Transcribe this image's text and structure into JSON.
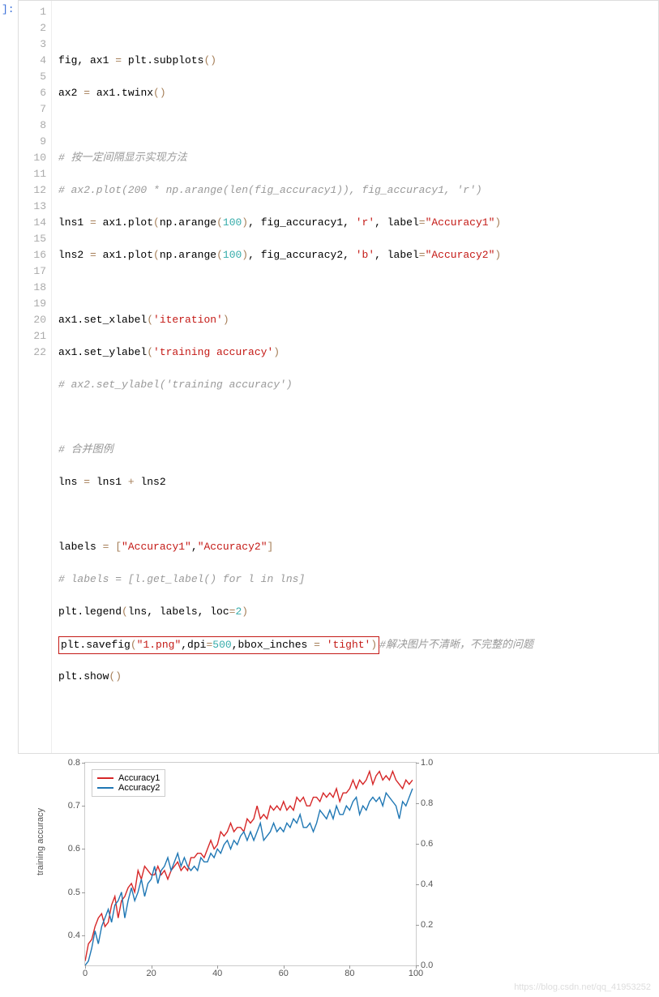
{
  "code": {
    "lines": [
      "",
      "fig, ax1 = plt.subplots()",
      "ax2 = ax1.twinx()",
      "",
      "# 按一定间隔显示实现方法",
      "# ax2.plot(200 * np.arange(len(fig_accuracy1)), fig_accuracy1, 'r')",
      "lns1 = ax1.plot(np.arange(100), fig_accuracy1, 'r', label=\"Accuracy1\")",
      "lns2 = ax1.plot(np.arange(100), fig_accuracy2, 'b', label=\"Accuracy2\")",
      "",
      "ax1.set_xlabel('iteration')",
      "ax1.set_ylabel('training accuracy')",
      "# ax2.set_ylabel('training accuracy')",
      "",
      "# 合并图例",
      "lns = lns1 + lns2",
      "",
      "labels = [\"Accuracy1\",\"Accuracy2\"]",
      "# labels = [l.get_label() for l in lns]",
      "plt.legend(lns, labels, loc=2)",
      "plt.savefig(\"1.png\",dpi=500,bbox_inches = 'tight')#解决图片不清晰，不完整的问题",
      "plt.show()",
      ""
    ]
  },
  "chart_data": {
    "type": "line",
    "xlabel": "iteration",
    "ylabel": "training accuracy",
    "x_ticks": [
      0,
      20,
      40,
      60,
      80,
      100
    ],
    "y_ticks_left": [
      0.4,
      0.5,
      0.6,
      0.7,
      0.8
    ],
    "y_ticks_right": [
      0.0,
      0.2,
      0.4,
      0.6,
      0.8,
      1.0
    ],
    "xlim": [
      0,
      100
    ],
    "ylim_left": [
      0.33,
      0.8
    ],
    "ylim_right": [
      0.0,
      1.0
    ],
    "legend_position": "upper-left",
    "series": [
      {
        "name": "Accuracy1",
        "color": "#d62728",
        "values": [
          0.34,
          0.38,
          0.39,
          0.42,
          0.44,
          0.45,
          0.42,
          0.43,
          0.47,
          0.49,
          0.44,
          0.48,
          0.49,
          0.51,
          0.52,
          0.5,
          0.55,
          0.53,
          0.56,
          0.55,
          0.54,
          0.54,
          0.56,
          0.54,
          0.55,
          0.53,
          0.55,
          0.56,
          0.57,
          0.55,
          0.56,
          0.55,
          0.58,
          0.58,
          0.59,
          0.59,
          0.58,
          0.6,
          0.62,
          0.6,
          0.61,
          0.64,
          0.63,
          0.64,
          0.66,
          0.64,
          0.65,
          0.65,
          0.64,
          0.67,
          0.66,
          0.67,
          0.7,
          0.67,
          0.68,
          0.67,
          0.7,
          0.69,
          0.7,
          0.69,
          0.71,
          0.69,
          0.7,
          0.69,
          0.72,
          0.71,
          0.72,
          0.7,
          0.7,
          0.72,
          0.72,
          0.71,
          0.73,
          0.72,
          0.73,
          0.72,
          0.74,
          0.71,
          0.73,
          0.73,
          0.74,
          0.76,
          0.74,
          0.76,
          0.75,
          0.76,
          0.78,
          0.75,
          0.77,
          0.78,
          0.76,
          0.77,
          0.76,
          0.78,
          0.76,
          0.75,
          0.74,
          0.76,
          0.75,
          0.76
        ]
      },
      {
        "name": "Accuracy2",
        "color": "#1f77b4",
        "values": [
          0.33,
          0.34,
          0.37,
          0.41,
          0.38,
          0.42,
          0.44,
          0.46,
          0.43,
          0.47,
          0.48,
          0.5,
          0.44,
          0.48,
          0.51,
          0.48,
          0.5,
          0.53,
          0.49,
          0.52,
          0.53,
          0.56,
          0.52,
          0.55,
          0.56,
          0.58,
          0.55,
          0.57,
          0.59,
          0.56,
          0.58,
          0.56,
          0.55,
          0.56,
          0.55,
          0.58,
          0.57,
          0.57,
          0.59,
          0.58,
          0.6,
          0.59,
          0.61,
          0.62,
          0.6,
          0.62,
          0.61,
          0.63,
          0.64,
          0.62,
          0.64,
          0.62,
          0.64,
          0.66,
          0.62,
          0.63,
          0.64,
          0.66,
          0.64,
          0.65,
          0.64,
          0.66,
          0.65,
          0.67,
          0.66,
          0.68,
          0.65,
          0.65,
          0.66,
          0.64,
          0.66,
          0.69,
          0.68,
          0.67,
          0.69,
          0.67,
          0.7,
          0.68,
          0.68,
          0.7,
          0.69,
          0.71,
          0.72,
          0.68,
          0.7,
          0.69,
          0.71,
          0.72,
          0.71,
          0.72,
          0.7,
          0.73,
          0.72,
          0.71,
          0.7,
          0.67,
          0.71,
          0.7,
          0.72,
          0.74
        ]
      }
    ]
  },
  "legend": {
    "l1": "Accuracy1",
    "l2": "Accuracy2"
  },
  "watermark": "https://blog.csdn.net/qq_41953252",
  "prompt": "]:"
}
